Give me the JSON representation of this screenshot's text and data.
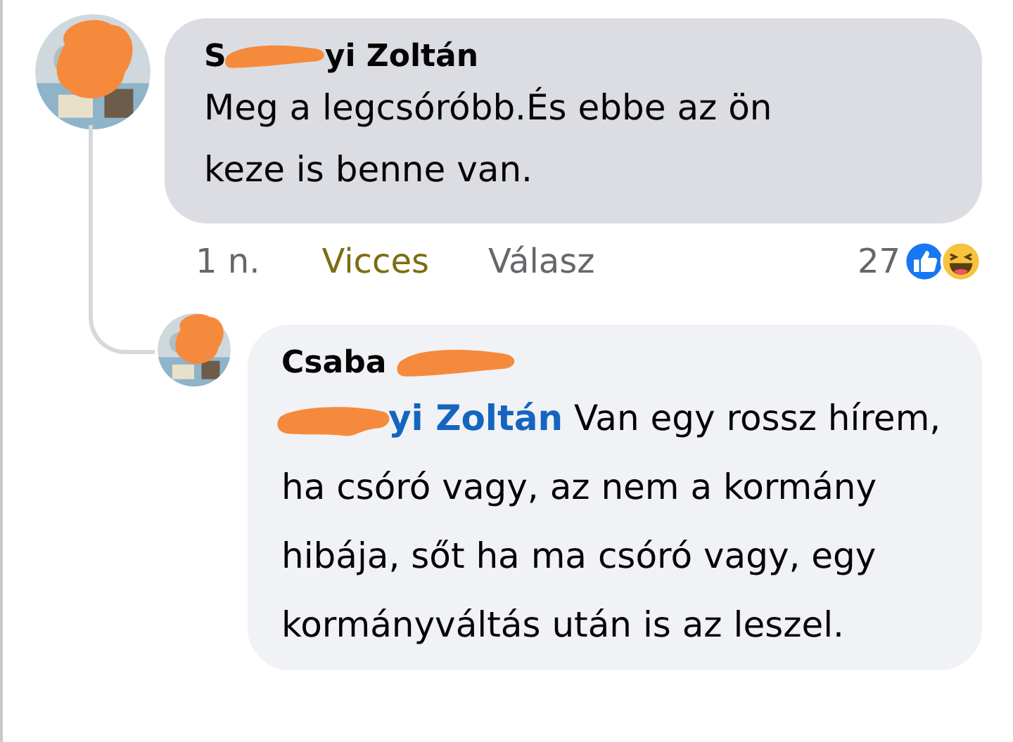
{
  "comments": [
    {
      "author": [
        {
          "text": "S"
        },
        {
          "kind": "redacted"
        },
        {
          "text": "yi Zoltán"
        }
      ],
      "text": "Meg a legcsóróbb.És ebbe az ön keze is benne van.",
      "time": "1 n.",
      "reaction_label": "Vicces",
      "reacted": true,
      "reply_label": "Válasz",
      "reaction_count": "27"
    }
  ],
  "replies": [
    {
      "author": [
        {
          "text": "Csaba"
        },
        {
          "kind": "redacted"
        }
      ],
      "mention": "yi Zoltán",
      "text": " Van egy rossz hírem, ha csóró vagy, az nem a kormány hibája, sőt ha ma csóró vagy, egy kormányváltás után is az leszel."
    }
  ]
}
